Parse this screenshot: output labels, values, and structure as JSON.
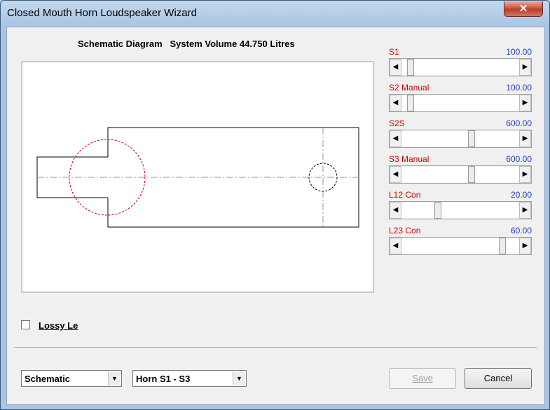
{
  "window": {
    "title": "Closed Mouth Horn Loudspeaker Wizard",
    "close_glyph": "✕"
  },
  "diagram": {
    "header": "Schematic Diagram   System Volume 44.750 Litres"
  },
  "params": [
    {
      "name": "S1",
      "value": "100.00",
      "slider_fraction": 0.05
    },
    {
      "name": "S2 Manual",
      "value": "100.00",
      "slider_fraction": 0.05
    },
    {
      "name": "S2S",
      "value": "600.00",
      "slider_fraction": 0.6
    },
    {
      "name": "S3 Manual",
      "value": "600.00",
      "slider_fraction": 0.6
    },
    {
      "name": "L12 Con",
      "value": "20.00",
      "slider_fraction": 0.3
    },
    {
      "name": "L23 Con",
      "value": "60.00",
      "slider_fraction": 0.88
    }
  ],
  "options": {
    "lossy_label": "Lossy Le",
    "lossy_checked": false
  },
  "footer": {
    "view_select": "Schematic",
    "horn_select": "Horn S1 - S3",
    "save_label": "Save",
    "cancel_label": "Cancel"
  },
  "colors": {
    "param_name": "#d10000",
    "param_value": "#1f3fbf",
    "driver_circle": "#d10000"
  },
  "icons": {
    "left_arrow": "◀",
    "right_arrow": "▶",
    "dropdown_arrow": "▼"
  }
}
